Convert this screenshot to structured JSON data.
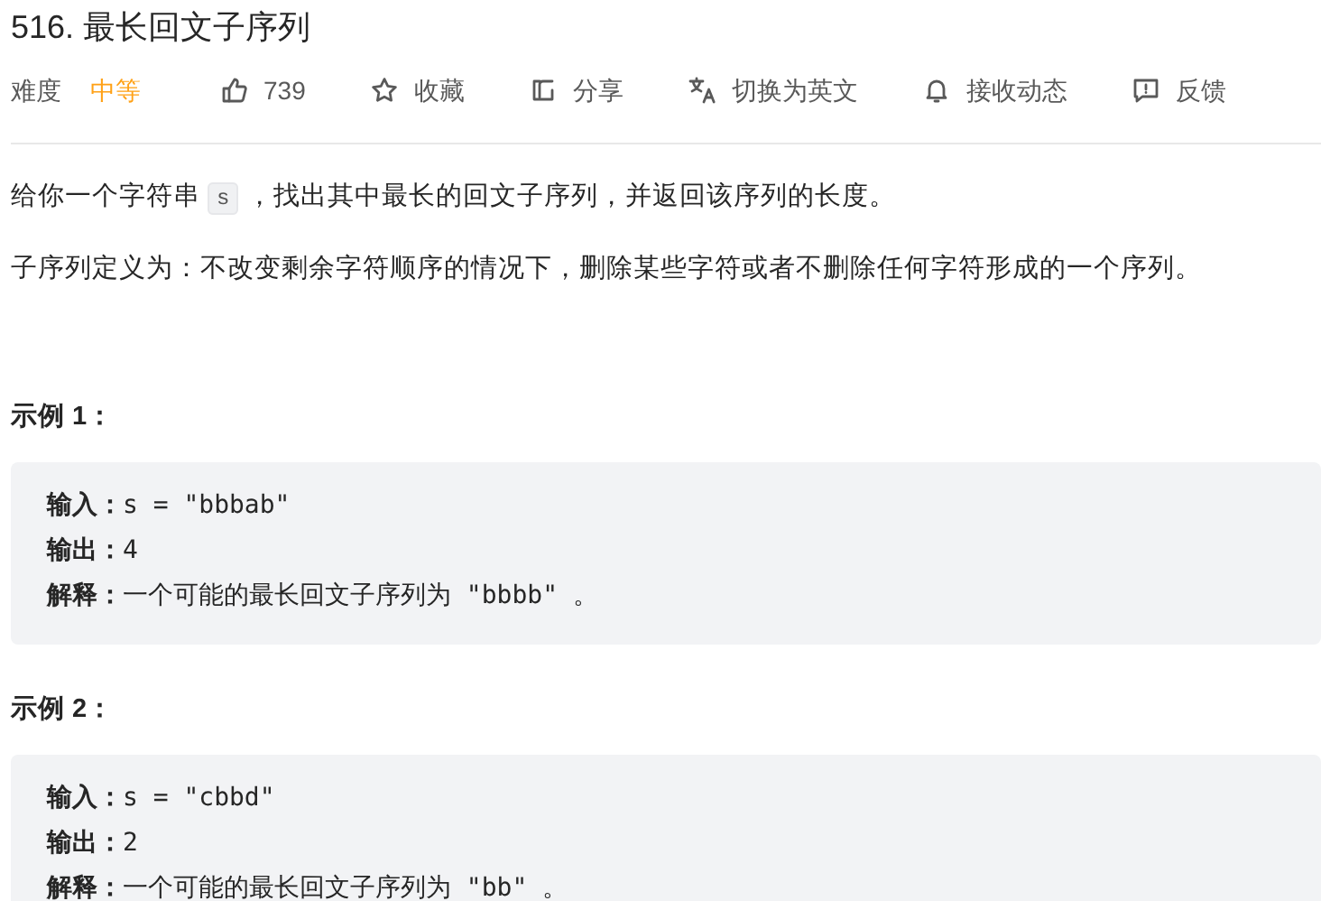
{
  "title": "516. 最长回文子序列",
  "meta": {
    "difficulty_label": "难度",
    "difficulty": "中等",
    "actions": [
      {
        "kind": "like",
        "label": "739"
      },
      {
        "kind": "star",
        "label": "收藏"
      },
      {
        "kind": "share",
        "label": "分享"
      },
      {
        "kind": "translate",
        "label": "切换为英文"
      },
      {
        "kind": "bell",
        "label": "接收动态"
      },
      {
        "kind": "feedback",
        "label": "反馈"
      }
    ]
  },
  "description": [
    {
      "before": "给你一个字符串 ",
      "code": "s",
      "after": " ，找出其中最长的回文子序列，并返回该序列的长度。"
    },
    {
      "before": "子序列定义为：不改变剩余字符顺序的情况下，删除某些字符或者不删除任何字符形成的一个序列。"
    }
  ],
  "examples": [
    {
      "heading": "示例 1：",
      "lines": [
        "**输入：**s = \"bbbab\"",
        "**输出：**4",
        "**解释：**一个可能的最长回文子序列为 \"bbbb\" 。"
      ]
    },
    {
      "heading": "示例 2：",
      "lines": [
        "**输入：**s = \"cbbd\"",
        "**输出：**2",
        "**解释：**一个可能的最长回文子序列为 \"bb\" 。"
      ]
    }
  ]
}
